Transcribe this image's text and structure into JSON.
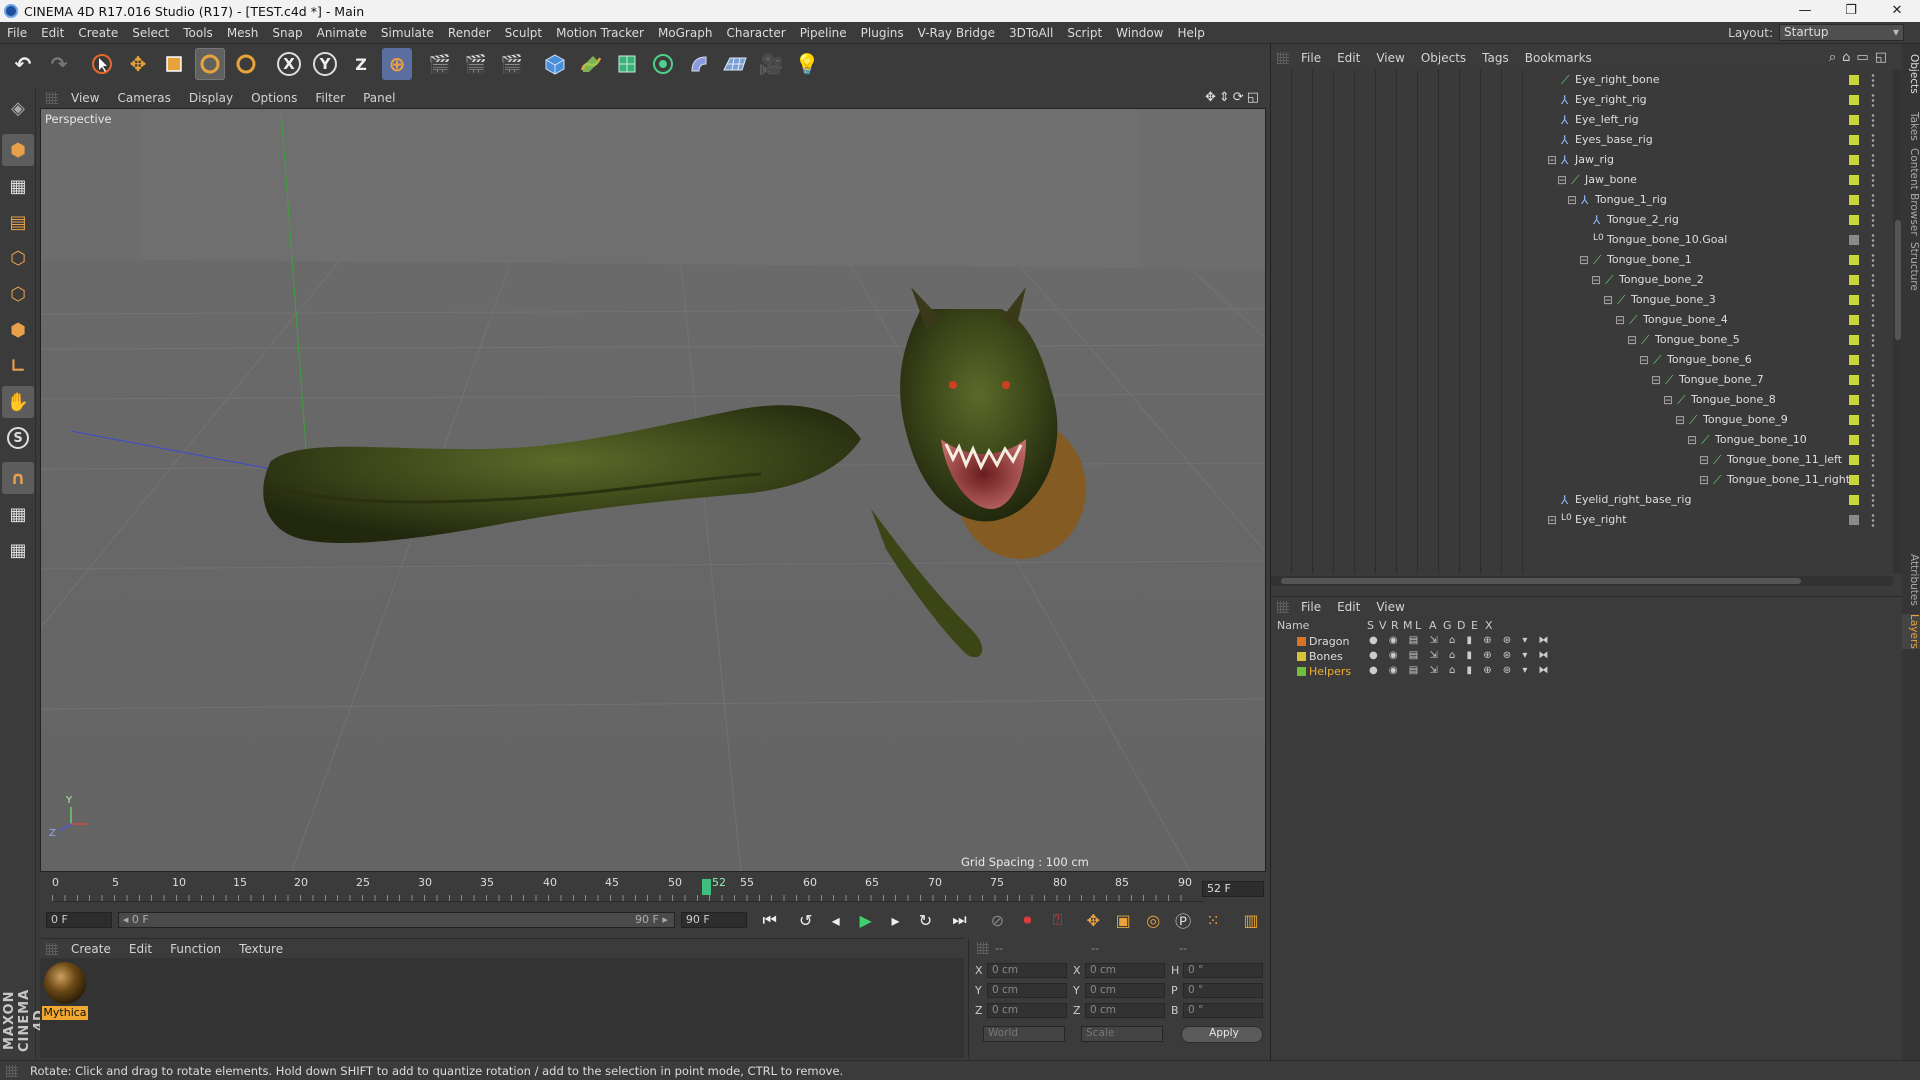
{
  "window": {
    "title": "CINEMA 4D R17.016 Studio (R17) - [TEST.c4d *] - Main",
    "controls": [
      "—",
      "❐",
      "✕"
    ]
  },
  "menu": [
    "File",
    "Edit",
    "Create",
    "Select",
    "Tools",
    "Mesh",
    "Snap",
    "Animate",
    "Simulate",
    "Render",
    "Sculpt",
    "Motion Tracker",
    "MoGraph",
    "Character",
    "Pipeline",
    "Plugins",
    "V-Ray Bridge",
    "3DToAll",
    "Script",
    "Window",
    "Help"
  ],
  "layout": {
    "label": "Layout:",
    "value": "Startup"
  },
  "toolbar": {
    "undo": "↶",
    "redo": "↷",
    "axis_x": "X",
    "axis_y": "Y",
    "axis_z": "Z"
  },
  "viewport": {
    "menu": [
      "View",
      "Cameras",
      "Display",
      "Options",
      "Filter",
      "Panel"
    ],
    "label": "Perspective",
    "grid_spacing": "Grid Spacing : 100 cm",
    "axis_y": "Y",
    "axis_z": "Z"
  },
  "timeline": {
    "ticks": [
      "0",
      "5",
      "10",
      "15",
      "20",
      "25",
      "30",
      "35",
      "40",
      "45",
      "50",
      "55",
      "60",
      "65",
      "70",
      "75",
      "80",
      "85",
      "90"
    ],
    "current": "52",
    "current_frame_field": "52 F",
    "start_field": "0 F",
    "range_start": "◂ 0 F",
    "range_end": "90 F ▸",
    "end_field": "90 F"
  },
  "material_panel": {
    "menu": [
      "Create",
      "Edit",
      "Function",
      "Texture"
    ],
    "material_name": "Mythica"
  },
  "coordinates": {
    "header": [
      "--",
      "--",
      "--"
    ],
    "rows": [
      {
        "l1": "X",
        "v1": "0 cm",
        "l2": "X",
        "v2": "0 cm",
        "l3": "H",
        "v3": "0 °"
      },
      {
        "l1": "Y",
        "v1": "0 cm",
        "l2": "Y",
        "v2": "0 cm",
        "l3": "P",
        "v3": "0 °"
      },
      {
        "l1": "Z",
        "v1": "0 cm",
        "l2": "Z",
        "v2": "0 cm",
        "l3": "B",
        "v3": "0 °"
      }
    ],
    "world": "World",
    "scale": "Scale",
    "apply": "Apply"
  },
  "status": "Rotate: Click and drag to rotate elements. Hold down SHIFT to add to quantize rotation / add to the selection in point mode, CTRL to remove.",
  "object_manager": {
    "menu": [
      "File",
      "Edit",
      "View",
      "Objects",
      "Tags",
      "Bookmarks"
    ],
    "objects": [
      {
        "name": "Eye_right_bone",
        "icon": "bone-icon",
        "glyph": "⟋"
      },
      {
        "name": "Eye_right_rig",
        "icon": "rig-icon",
        "glyph": "⅄"
      },
      {
        "name": "Eye_left_rig",
        "icon": "rig-icon",
        "glyph": "⅄"
      },
      {
        "name": "Eyes_base_rig",
        "icon": "rig-icon",
        "glyph": "⅄"
      },
      {
        "name": "Jaw_rig",
        "icon": "rig-icon",
        "glyph": "⅄"
      },
      {
        "name": "Jaw_bone",
        "icon": "bone-icon",
        "glyph": "⟋"
      },
      {
        "name": "Tongue_1_rig",
        "icon": "rig-icon",
        "glyph": "⅄"
      },
      {
        "name": "Tongue_2_rig",
        "icon": "rig-icon",
        "glyph": "⅄"
      },
      {
        "name": "Tongue_bone_10.Goal",
        "icon": "null-icon",
        "glyph": "L0"
      },
      {
        "name": "Tongue_bone_1",
        "icon": "bone-icon",
        "glyph": "⟋"
      },
      {
        "name": "Tongue_bone_2",
        "icon": "bone-icon",
        "glyph": "⟋"
      },
      {
        "name": "Tongue_bone_3",
        "icon": "bone-icon",
        "glyph": "⟋"
      },
      {
        "name": "Tongue_bone_4",
        "icon": "bone-icon",
        "glyph": "⟋"
      },
      {
        "name": "Tongue_bone_5",
        "icon": "bone-icon",
        "glyph": "⟋"
      },
      {
        "name": "Tongue_bone_6",
        "icon": "bone-icon",
        "glyph": "⟋"
      },
      {
        "name": "Tongue_bone_7",
        "icon": "bone-icon",
        "glyph": "⟋"
      },
      {
        "name": "Tongue_bone_8",
        "icon": "bone-icon",
        "glyph": "⟋"
      },
      {
        "name": "Tongue_bone_9",
        "icon": "bone-icon",
        "glyph": "⟋"
      },
      {
        "name": "Tongue_bone_10",
        "icon": "bone-icon",
        "glyph": "⟋"
      },
      {
        "name": "Tongue_bone_11_left",
        "icon": "bone-icon",
        "glyph": "⟋"
      },
      {
        "name": "Tongue_bone_11_right",
        "icon": "bone-icon",
        "glyph": "⟋"
      },
      {
        "name": "Eyelid_right_base_rig",
        "icon": "rig-icon",
        "glyph": "⅄"
      },
      {
        "name": "Eye_right",
        "icon": "null-icon",
        "glyph": "L0"
      }
    ]
  },
  "layer_manager": {
    "menu": [
      "File",
      "Edit",
      "View"
    ],
    "columns": [
      "Name",
      "S",
      "V",
      "R",
      "M",
      "L",
      "A",
      "G",
      "D",
      "E",
      "X"
    ],
    "layers": [
      {
        "name": "Dragon",
        "color": "#d8742a"
      },
      {
        "name": "Bones",
        "color": "#d8c23a"
      },
      {
        "name": "Helpers",
        "color": "#6fbf3a"
      }
    ]
  },
  "side_tabs": [
    "Objects",
    "Takes",
    "Content Browser",
    "Structure",
    "Attributes",
    "Layers"
  ],
  "maxon": "MAXON CINEMA 4D"
}
